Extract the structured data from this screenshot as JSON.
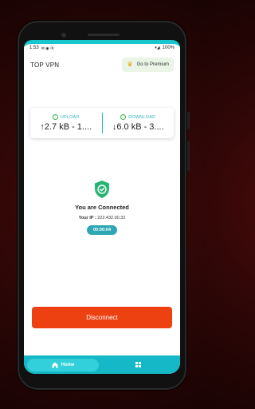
{
  "statusbar": {
    "time": "1:53",
    "battery": "100%"
  },
  "appbar": {
    "title": "TOP VPN",
    "premium_label": "Go to Premium"
  },
  "stats": {
    "upload": {
      "label": "UPLOAD",
      "value": "↑2.7 kB - 1...."
    },
    "download": {
      "label": "DOWNLOAD",
      "value": "↓6.0 kB - 3...."
    }
  },
  "connection": {
    "status": "You are Connected",
    "ip_label": "Your IP :",
    "ip_value": "222.432.00.32",
    "timer": "00:00:04"
  },
  "actions": {
    "disconnect_label": "Disconnect"
  },
  "nav": {
    "home_label": "Home"
  },
  "colors": {
    "accent": "#19c6cf",
    "disconnect": "#ee4112",
    "shield": "#29b473"
  }
}
